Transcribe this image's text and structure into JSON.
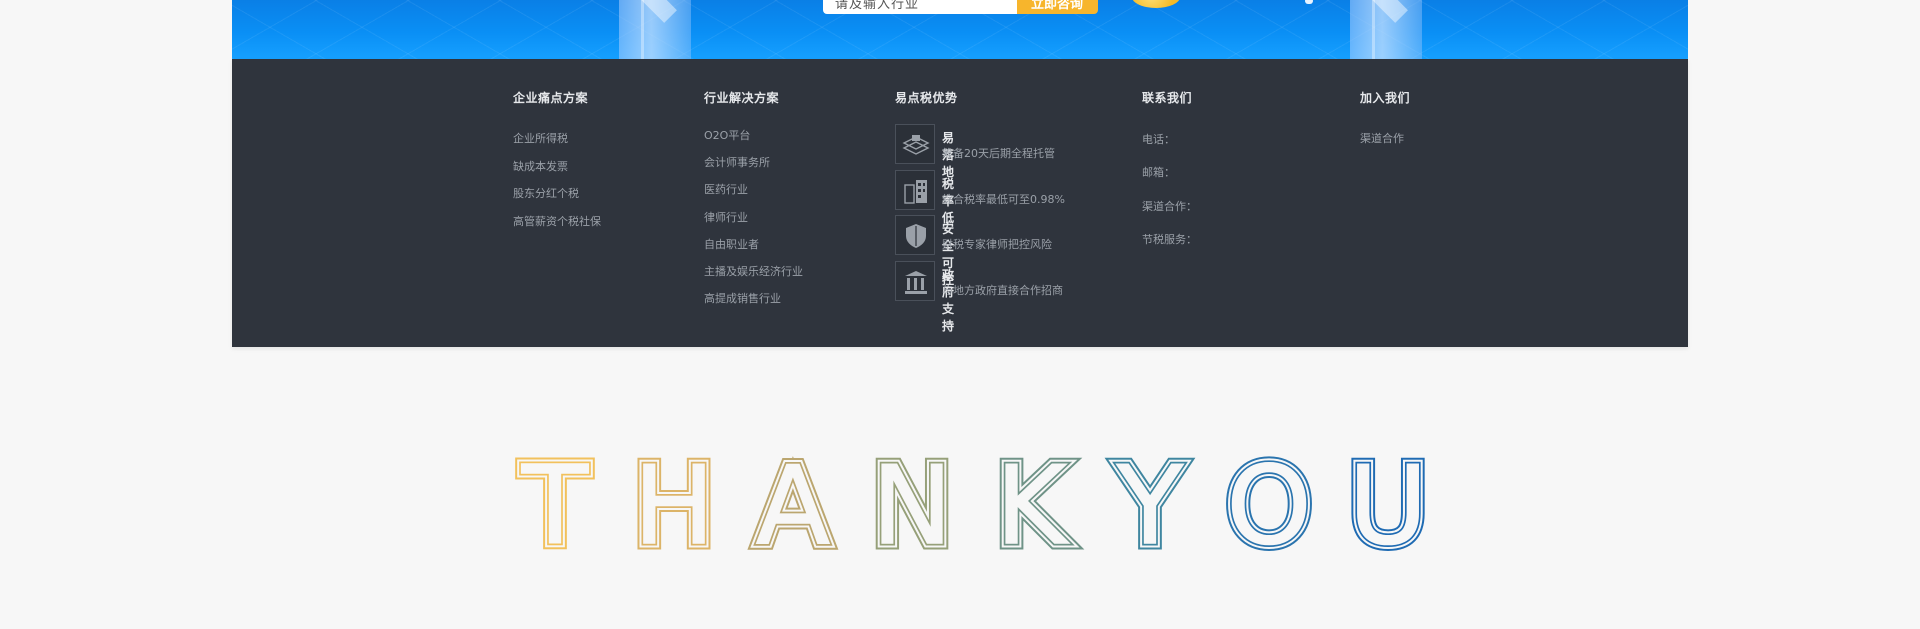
{
  "hero": {
    "search_placeholder": "请及输入行业",
    "search_button": "立即咨询"
  },
  "footer": {
    "columns": [
      {
        "title": "企业痛点方案",
        "items": [
          "企业所得税",
          "缺成本发票",
          "股东分红个税",
          "高管薪资个税社保"
        ]
      },
      {
        "title": "行业解决方案",
        "items": [
          "O2O平台",
          "会计师事务所",
          "医药行业",
          "律师行业",
          "自由职业者",
          "主播及娱乐经济行业",
          "高提成销售行业"
        ]
      },
      {
        "title": "易点税优势",
        "advantages": [
          {
            "icon": "platform-icon",
            "title": "易落地",
            "desc": "筹备20天后期全程托管"
          },
          {
            "icon": "building-icon",
            "title": "税率低",
            "desc": "综合税率最低可至0.98%"
          },
          {
            "icon": "shield-icon",
            "title": "安全可控",
            "desc": "财税专家律师把控风险"
          },
          {
            "icon": "government-icon",
            "title": "政府支持",
            "desc": "与地方政府直接合作招商"
          }
        ]
      },
      {
        "title": "联系我们",
        "items": [
          "电话：",
          "邮箱：",
          "渠道合作：",
          "节税服务："
        ]
      },
      {
        "title": "加入我们",
        "items": [
          "渠道合作"
        ]
      }
    ]
  },
  "thanks": {
    "letters": [
      "T",
      "H",
      "A",
      "N",
      "K",
      "Y",
      "O",
      "U"
    ],
    "colors": [
      "#f2c15c",
      "#dcb468",
      "#bba66f",
      "#96a079",
      "#6f9387",
      "#3f86a0",
      "#2a74ae",
      "#1f6bb3"
    ]
  }
}
